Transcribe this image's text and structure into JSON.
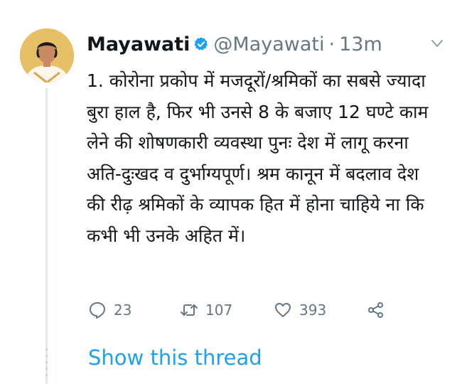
{
  "tweet": {
    "author_name": "Mayawati",
    "verified": true,
    "handle": "@Mayawati",
    "separator": "·",
    "time_ago": "13m",
    "body": "1. कोरोना प्रकोप में मजदूरों/श्रमिकों का सबसे ज्यादा\nबुरा हाल है, फिर भी उनसे 8 के बजाए 12 घण्टे काम\nलेने की शोषणकारी व्यवस्था पुनः देश में लागू करना\nअति-दुःखद व दुर्भाग्यपूर्ण। श्रम कानून में बदलाव देश\nकी रीढ़ श्रमिकों के व्यापक हित में होना चाहिये ना कि\nकभी भी उनके अहित में।",
    "stats": {
      "replies": "23",
      "retweets": "107",
      "likes": "393"
    },
    "show_thread_label": "Show this thread"
  },
  "icons": {
    "verified": "verified-badge-icon",
    "caret": "chevron-down-icon",
    "reply": "reply-icon",
    "retweet": "retweet-icon",
    "like": "heart-icon",
    "share": "share-icon"
  },
  "colors": {
    "link_blue": "#1da1f2",
    "muted_gray": "#657786",
    "text_dark": "#14171a",
    "thread_line": "#e1e8ed"
  }
}
